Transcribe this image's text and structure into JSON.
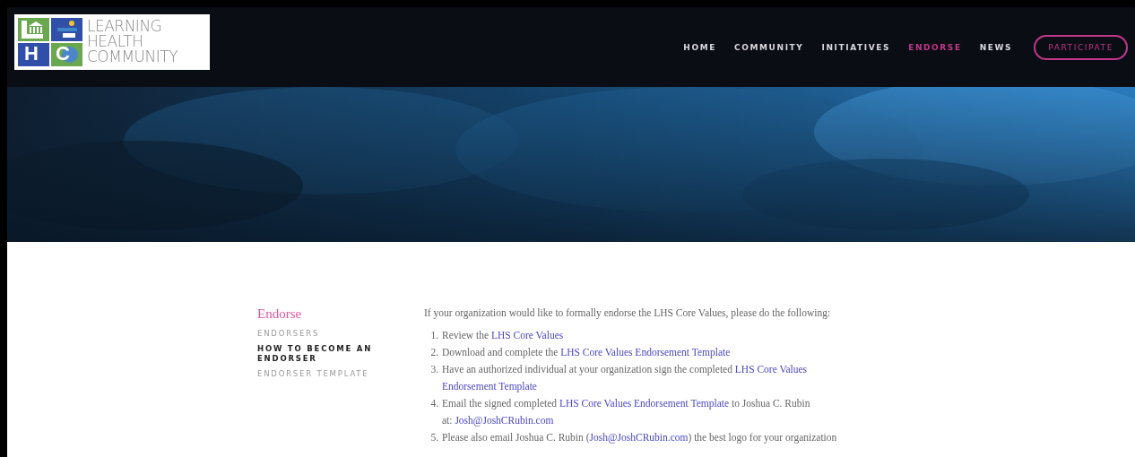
{
  "logo": {
    "letters": [
      "H",
      "C"
    ],
    "lines": [
      "LEARNING",
      "HEALTH",
      "COMMUNITY"
    ]
  },
  "nav": [
    {
      "label": "HOME",
      "selected": false
    },
    {
      "label": "COMMUNITY",
      "selected": false
    },
    {
      "label": "INITIATIVES",
      "selected": false
    },
    {
      "label": "ENDORSE",
      "selected": true
    },
    {
      "label": "NEWS",
      "selected": false
    }
  ],
  "cta": "PARTICIPATE",
  "sidebar": {
    "title": "Endorse",
    "items": [
      {
        "label": "ENDORSERS",
        "selected": false
      },
      {
        "label": "HOW TO BECOME AN ENDORSER",
        "selected": true
      },
      {
        "label": "ENDORSER TEMPLATE",
        "selected": false
      }
    ]
  },
  "intro": "If your organization would like to formally endorse the LHS Core Values, please do the following:",
  "steps": [
    {
      "number": "1.",
      "lines": [
        [
          {
            "kind": "text",
            "text": "Review the "
          },
          {
            "kind": "link",
            "text": "LHS Core Values"
          }
        ]
      ]
    },
    {
      "number": "2.",
      "lines": [
        [
          {
            "kind": "text",
            "text": "Download and complete the "
          },
          {
            "kind": "link",
            "text": "LHS Core Values Endorsement Template"
          }
        ]
      ]
    },
    {
      "number": "3.",
      "lines": [
        [
          {
            "kind": "text",
            "text": "Have an authorized individual at your organization sign the completed "
          },
          {
            "kind": "link",
            "text": "LHS Core Values"
          }
        ],
        [
          {
            "kind": "link",
            "text": "Endorsement Template"
          }
        ]
      ]
    },
    {
      "number": "4.",
      "lines": [
        [
          {
            "kind": "text",
            "text": "Email the signed completed "
          },
          {
            "kind": "link",
            "text": "LHS Core Values Endorsement Template"
          },
          {
            "kind": "text",
            "text": " to Joshua C. Rubin"
          }
        ],
        [
          {
            "kind": "text",
            "text": "at: "
          },
          {
            "kind": "link",
            "text": "Josh@JoshCRubin.com"
          }
        ]
      ]
    },
    {
      "number": "5.",
      "lines": [
        [
          {
            "kind": "text",
            "text": "Please also email Joshua C. Rubin ("
          },
          {
            "kind": "link",
            "text": "Josh@JoshCRubin.com"
          },
          {
            "kind": "text",
            "text": ") the best logo for your organization"
          }
        ]
      ]
    }
  ]
}
